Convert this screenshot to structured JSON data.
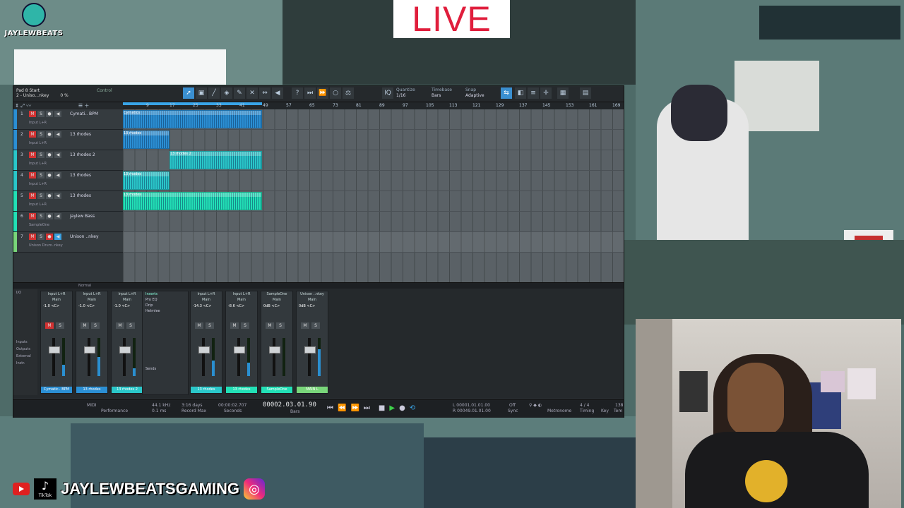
{
  "stream": {
    "brand": "JAYLEWBEATS",
    "live_label": "LIVE",
    "handle": "JAYLEWBEATSGAMING",
    "tiktok_label": "TikTok"
  },
  "daw": {
    "song": {
      "line1": "Pad 8 Start",
      "line2": "2 - Uniso...nkey",
      "pct": "0 %"
    },
    "control_label": "Control",
    "quantize": {
      "label": "Quantize",
      "value": "1/16"
    },
    "timebase": {
      "label": "Timebase",
      "value": "Bars"
    },
    "snap": {
      "label": "Snap",
      "value": "Adaptive"
    },
    "ruler": [
      "9",
      "17",
      "25",
      "33",
      "41",
      "49",
      "57",
      "65",
      "73",
      "81",
      "89",
      "97",
      "105",
      "113",
      "121",
      "129",
      "137",
      "145",
      "153",
      "161",
      "169"
    ],
    "tracks": [
      {
        "num": "1",
        "name": "Cymati.. BPM",
        "input": "Input L+R",
        "color": "#2b8fd4"
      },
      {
        "num": "2",
        "name": "13 rhodes",
        "input": "Input L+R",
        "color": "#2b8fd4"
      },
      {
        "num": "3",
        "name": "13 rhodes 2",
        "input": "Input L+R",
        "color": "#2ac7c9"
      },
      {
        "num": "4",
        "name": "13 rhodes",
        "input": "Input L+R",
        "color": "#2ac7c9"
      },
      {
        "num": "5",
        "name": "13 rhodes",
        "input": "Input L+R",
        "color": "#22e0b6"
      },
      {
        "num": "6",
        "name": "jaylew Bass",
        "input": "SampleOne",
        "color": "#22e0b6"
      },
      {
        "num": "7",
        "name": "Unison ..nkey",
        "input": "Unison Drum..nkey",
        "color": "#79d67a"
      }
    ],
    "clips": {
      "cymatics": "Cymatics",
      "rhodes": "13 rhodes",
      "rhodes2": "13 rhodes 2"
    },
    "mixer": {
      "left_labels": [
        "I/O",
        "Inputs",
        "Outputs",
        "External",
        "Instr."
      ],
      "norm_label": "Normal",
      "inserts_title": "Inserts",
      "inserts": [
        "Pro EQ",
        "Drip",
        "Helmlee"
      ],
      "sends_label": "Sends",
      "strips": [
        {
          "input": "Input L+R",
          "out": "Main",
          "val": "-1.0",
          "pan": "<C>",
          "name": "Cymatic.. BPM",
          "color": "#2b8fd4",
          "level": 0.3,
          "mute": true
        },
        {
          "input": "Input L+R",
          "out": "Main",
          "val": "-1.0",
          "pan": "<C>",
          "name": "13 rhodes",
          "color": "#2b8fd4",
          "level": 0.5,
          "mute": false
        },
        {
          "input": "Input L+R",
          "out": "Main",
          "val": "-1.0",
          "pan": "<C>",
          "name": "13 rhodes 2",
          "color": "#2ac7c9",
          "level": 0.2,
          "mute": false
        },
        {
          "input": "Input L+R",
          "out": "Main",
          "val": "-14.3",
          "pan": "<C>",
          "name": "13 rhodes",
          "color": "#2ac7c9",
          "level": 0.4,
          "mute": false
        },
        {
          "input": "Input L+R",
          "out": "Main",
          "val": "-8.6",
          "pan": "<C>",
          "name": "13 rhodes",
          "color": "#22e0b6",
          "level": 0.35,
          "mute": false
        },
        {
          "input": "SampleOne",
          "out": "Main",
          "val": "0dB",
          "pan": "<C>",
          "name": "SampleOne",
          "color": "#22e0b6",
          "level": 0.0,
          "mute": false
        },
        {
          "input": "Unison ..nkey",
          "out": "Main",
          "val": "0dB",
          "pan": "<C>",
          "name": "MAIN L",
          "color": "#79d67a",
          "level": 0.7,
          "mute": false
        }
      ],
      "auto_label": "Auto: Off"
    },
    "transport": {
      "midi": "MIDI",
      "performance": "Performance",
      "rate": "44.1 kHz",
      "latency": "0.1 ms",
      "record_max": "3:16 days",
      "record_max_label": "Record Max",
      "seconds": "00:00:02.707",
      "seconds_label": "Seconds",
      "bars": "00002.03.01.90",
      "bars_label": "Bars",
      "loop_start": "L 00001.01.01.00",
      "loop_end": "R 00049.01.01.00",
      "sync": "Off",
      "sync_label": "Sync",
      "metronome_label": "Metronome",
      "timing": "4 / 4",
      "timing_label": "Timing",
      "key_label": "Key",
      "tempo": "138",
      "tempo_label": "Tem"
    }
  }
}
